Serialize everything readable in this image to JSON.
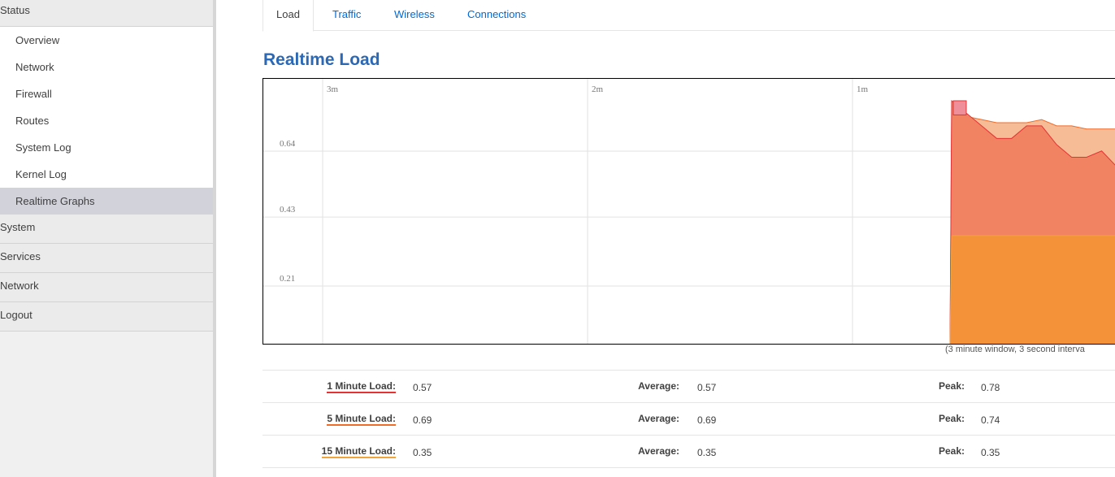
{
  "sidebar": {
    "status_label": "Status",
    "items": [
      {
        "label": "Overview"
      },
      {
        "label": "Network"
      },
      {
        "label": "Firewall"
      },
      {
        "label": "Routes"
      },
      {
        "label": "System Log"
      },
      {
        "label": "Kernel Log"
      },
      {
        "label": "Realtime Graphs"
      }
    ],
    "sections": [
      {
        "label": "System"
      },
      {
        "label": "Services"
      },
      {
        "label": "Network"
      },
      {
        "label": "Logout"
      }
    ]
  },
  "tabs": [
    {
      "label": "Load"
    },
    {
      "label": "Traffic"
    },
    {
      "label": "Wireless"
    },
    {
      "label": "Connections"
    }
  ],
  "page_title": "Realtime Load",
  "window_note": "(3 minute window, 3 second interva",
  "stats": [
    {
      "label": "1 Minute Load:",
      "value": "0.57",
      "avg_label": "Average:",
      "avg": "0.57",
      "peak_label": "Peak:",
      "peak": "0.78"
    },
    {
      "label": "5 Minute Load:",
      "value": "0.69",
      "avg_label": "Average:",
      "avg": "0.69",
      "peak_label": "Peak:",
      "peak": "0.74"
    },
    {
      "label": "15 Minute Load:",
      "value": "0.35",
      "avg_label": "Average:",
      "avg": "0.35",
      "peak_label": "Peak:",
      "peak": "0.35"
    }
  ],
  "colors": {
    "load_1m": "#e33333",
    "load_5m": "#f06c2a",
    "load_15m": "#f2a43b",
    "title": "#2b68b5",
    "link": "#0069d6"
  },
  "chart_data": {
    "type": "area",
    "x_labels": [
      "3m",
      "2m",
      "1m"
    ],
    "y_ticks": [
      "0.64",
      "0.43",
      "0.21"
    ],
    "ylim": [
      0,
      0.85
    ],
    "series": [
      {
        "name": "1 Minute Load",
        "values": [
          0.78,
          0.74,
          0.7,
          0.66,
          0.66,
          0.7,
          0.7,
          0.64,
          0.6,
          0.6,
          0.62,
          0.57
        ]
      },
      {
        "name": "5 Minute Load",
        "values": [
          0.74,
          0.73,
          0.72,
          0.71,
          0.71,
          0.71,
          0.72,
          0.7,
          0.7,
          0.69,
          0.69,
          0.69
        ]
      },
      {
        "name": "15 Minute Load",
        "values": [
          0.35,
          0.35,
          0.35,
          0.35,
          0.35,
          0.35,
          0.35,
          0.35,
          0.35,
          0.35,
          0.35,
          0.35
        ]
      }
    ]
  }
}
